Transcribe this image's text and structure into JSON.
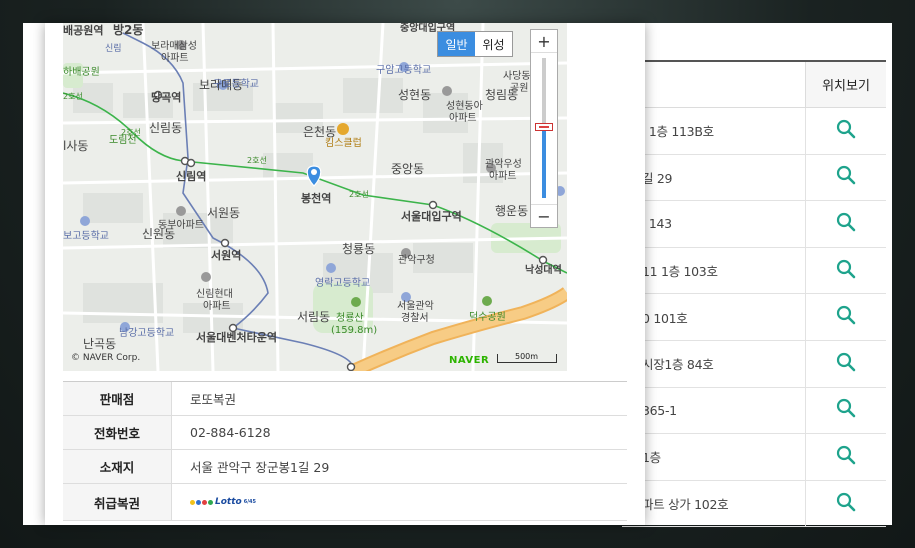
{
  "stores_table": {
    "header_location": "위치보기",
    "rows": [
      {
        "address_fragment": "l 1층 113B호"
      },
      {
        "address_fragment": "길 29"
      },
      {
        "address_fragment": "l 143"
      },
      {
        "address_fragment": "11 1층 103호"
      },
      {
        "address_fragment": "0 101호"
      },
      {
        "address_fragment": "시장1층 84호"
      },
      {
        "address_fragment": "365-1"
      },
      {
        "address_fragment": "1층"
      },
      {
        "address_fragment": "파트 상가 102호"
      }
    ]
  },
  "map": {
    "toggle": {
      "normal": "일반",
      "satellite": "위성"
    },
    "zoom_in": "+",
    "zoom_out": "−",
    "zoom_level": 0.5,
    "copyright": "© NAVER Corp.",
    "brand": "NAVER",
    "scale": "500m",
    "marker_label": "봉천역",
    "labels": {
      "l1": "배공원역",
      "l2": "방2동",
      "l3": "신림",
      "l4": "보라매삼성",
      "l5": "아파트",
      "l6": "중앙대입구역",
      "l7": "구암고등학교",
      "l8": "사당동",
      "l9": "공원",
      "l10": "하배공원",
      "l11": "보라매동",
      "l12": "구로등학교",
      "l13": "성현동",
      "l14": "청림동",
      "l15": "당곡역",
      "l16": "성현동아",
      "l17": "아파트",
      "l18": "신림동",
      "l19": "은천동",
      "l20": "킴스클럽",
      "l21": "도림천",
      "l22": "l사동",
      "l23": "중앙동",
      "l24": "관악우성",
      "l25": "아파트",
      "l26": "2호선",
      "l27": "신림역",
      "l28": "2호선",
      "l29": "봉천역",
      "l30": "2호선",
      "l31": "서울대입구역",
      "l32": "행운동",
      "l33": "서원동",
      "l34": "동부아파트",
      "l35": "보고등학교",
      "l36": "신원동",
      "l37": "청룡동",
      "l38": "관악구청",
      "l39": "낙성대역",
      "l40": "서원역",
      "l41": "영락고등학교",
      "l42": "신림현대",
      "l43": "아파트",
      "l44": "서울관악",
      "l45": "경찰서",
      "l46": "덕수공원",
      "l47": "남강고등학교",
      "l48": "서림동",
      "l49": "청룡산",
      "l50": "(159.8m)",
      "l51": "서울대벤처타운역",
      "l52": "난곡동",
      "l53": "2호선"
    }
  },
  "store_info": {
    "rows": [
      {
        "key": "판매점",
        "value": "로또복권"
      },
      {
        "key": "전화번호",
        "value": "02-884-6128"
      },
      {
        "key": "소재지",
        "value": "서울 관악구 장군봉1길 29"
      },
      {
        "key": "취급복권",
        "value": ""
      }
    ],
    "lotto_logo_text": "Lotto",
    "lotto_logo_sub": "6/45"
  },
  "colors": {
    "search_icon": "#1ea38c",
    "line2": "#3cb44b",
    "marker": "#3b8de0",
    "toggle_active": "#3b8de0",
    "road_major": "#f0b35a"
  }
}
